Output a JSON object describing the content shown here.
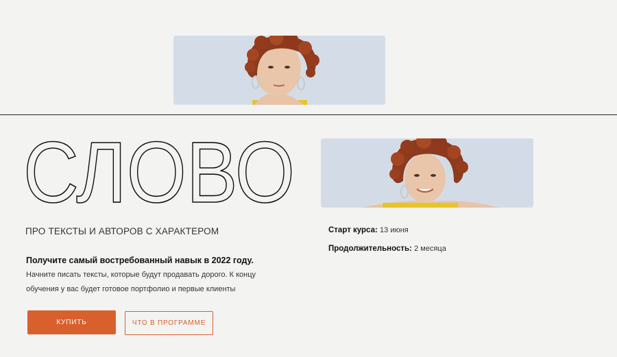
{
  "hero": {
    "title": "СЛОВО",
    "tagline": "ПРО ТЕКСТЫ И АВТОРОВ С ХАРАКТЕРОМ",
    "headline": "Получите самый востребованный навык в 2022 году.",
    "description": "Начните писать тексты, которые будут продавать дорого. К концу обучения у вас будет готовое портфолио и первые клиенты"
  },
  "course": {
    "start_label": "Старт курса:",
    "start_value": "13 июня",
    "duration_label": "Продолжительность:",
    "duration_value": "2 месяца"
  },
  "buttons": {
    "buy": "КУПИТЬ",
    "program": "ЧТО В ПРОГРАММЕ"
  },
  "colors": {
    "accent": "#d9602c",
    "background": "#f3f3f1",
    "text": "#111111"
  }
}
